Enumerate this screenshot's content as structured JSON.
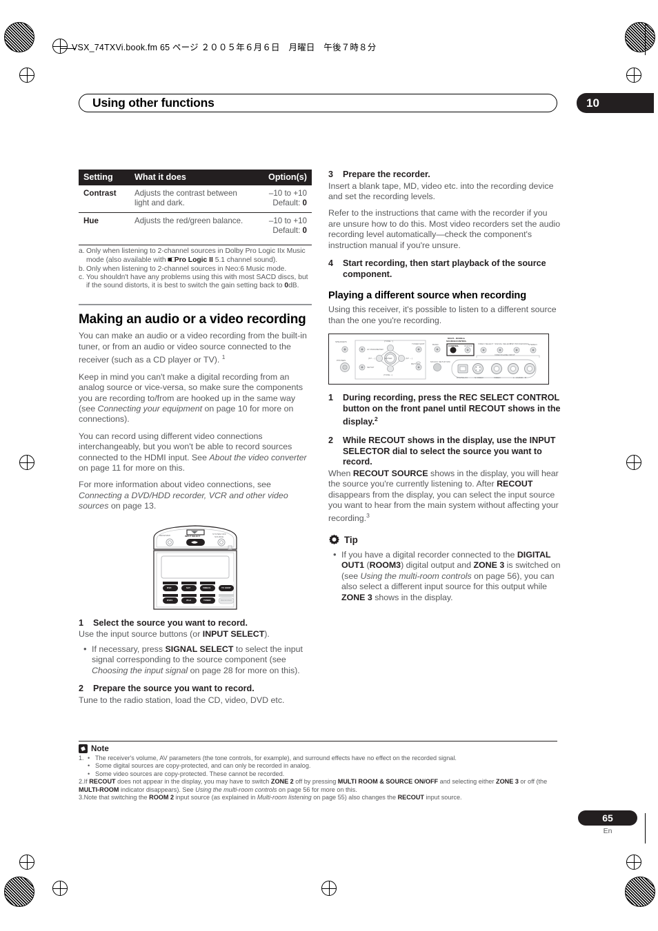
{
  "header": {
    "slug": "VSX_74TXVi.book.fm  65 ページ  ２００５年６月６日　月曜日　午後７時８分",
    "chapter_title": "Using other functions",
    "chapter_number": "10"
  },
  "settings_table": {
    "columns": [
      "Setting",
      "What it does",
      "Option(s)"
    ],
    "rows": [
      {
        "name": "Contrast",
        "desc": "Adjusts the contrast between light and dark.",
        "options_range": "–10 to +10",
        "options_default_label": "Default: ",
        "options_default_value": "0"
      },
      {
        "name": "Hue",
        "desc": "Adjusts the red/green balance.",
        "options_range": "–10 to +10",
        "options_default_label": "Default: ",
        "options_default_value": "0"
      }
    ],
    "footnotes": [
      {
        "label": "a.",
        "text_1": "Only when listening to 2-channel sources in Dolby Pro Logic IIx Music mode (also available with ",
        "glyph": "■□",
        "bold": "Pro Logic II",
        "text_2": " 5.1 channel sound)."
      },
      {
        "label": "b.",
        "text_1": "Only when listening to 2-channel sources in Neo:6 Music mode."
      },
      {
        "label": "c.",
        "text_1": "You shouldn't have any problems using this with most SACD discs, but if the sound distorts, it is best to switch the gain setting back to ",
        "bold": "0",
        "text_2": "dB."
      }
    ]
  },
  "left_column": {
    "section_title": "Making an audio or a video recording",
    "p1_a": "You can make an audio or a video recording from the built-in tuner, or from an audio or video source connected to the receiver (such as a CD player or TV).",
    "p1_sup": "1",
    "p2_a": "Keep in mind you can't make a digital recording from an analog source or vice-versa, so make sure the components you are recording to/from are hooked up in the same way (see ",
    "p2_i": "Connecting your equipment",
    "p2_b": " on page 10 for more on connections).",
    "p3_a": "You can record using different video connections interchangeably, but you won't be able to record sources connected to the HDMI input. See ",
    "p3_i": "About the video converter",
    "p3_b": " on page 11 for more on this.",
    "p4_a": "For more information about video connections, see ",
    "p4_i": "Connecting a DVD/HDD recorder, VCR and other video sources",
    "p4_b": " on page 13.",
    "remote_figure": {
      "label_receiver": "RECEIVER",
      "label_input_select": "INPUT SELECT",
      "label_system_off": "SYSTEM OFF",
      "label_source": "SOURCE",
      "buttons_row1_top": [
        "CD",
        "TV",
        "CD-R/CD2"
      ],
      "buttons_row1": [
        "DVD",
        "SAT",
        "VIDEO1",
        "TV CONT"
      ],
      "buttons_row2_top": [
        "VIDEO2",
        "CD-R",
        "MD/CD-R"
      ],
      "buttons_row2": [
        "DVR1",
        "iPod",
        "TUNER",
        "RECEIVER"
      ]
    },
    "steps": [
      {
        "num": "1",
        "head": "Select the source you want to record.",
        "body_a": "Use the input source buttons (or ",
        "body_b": "INPUT SELECT",
        "body_c": ").",
        "bullets": [
          {
            "a": "If necessary, press ",
            "b": "SIGNAL SELECT",
            "c": " to select the input signal corresponding to the source component (see ",
            "i": "Choosing the input signal",
            "d": " on page 28 for more on this)."
          }
        ]
      },
      {
        "num": "2",
        "head": "Prepare the source you want to record.",
        "body_a": "Tune to the radio station, load the CD, video, DVD etc."
      }
    ]
  },
  "right_column": {
    "steps_top": [
      {
        "num": "3",
        "head": "Prepare the recorder.",
        "body_a": "Insert a blank tape, MD, video etc. into the recording device and set the recording levels.",
        "body_b": "Refer to the instructions that came with the recorder if you are unsure how to do this. Most video recorders set the audio recording level automatically—check the component's instruction manual if you're unsure."
      },
      {
        "num": "4",
        "head": "Start recording, then start playback of the source component."
      }
    ],
    "section_title": "Playing a different source when recording",
    "intro": "Using this receiver, it's possible to listen to a different source than the one you're recording.",
    "panel_figure": {
      "labels": [
        "SPEAKERS",
        "PHONES",
        "AV PARAMETER",
        "SETUP",
        "ENTER",
        "(TUNE ↑)",
        "(TUNE ↓)",
        "(ST ←)",
        "(ST →)",
        "TUNER EDIT",
        "RETURN",
        "BAND",
        "MCACC SETUP MIC",
        "MULTI - ROOM &",
        "SOURCE/CONTROL",
        "CONTROL",
        "ON/OFF",
        "VIDEO SELECT",
        "SIGNAL SELECT",
        "DSP PROCESSING",
        "STEREO",
        "VIDEO/GAME INPUT",
        "DIGITAL IN",
        "S-VIDEO",
        "VIDEO",
        "L - AUDIO - R"
      ]
    },
    "steps_bottom": [
      {
        "num": "1",
        "head_a": "During recording, press the ",
        "head_b": "REC SELECT CONTROL",
        "head_c": " button on the front panel until ",
        "head_d": "RECOUT",
        "head_e": " shows in the display.",
        "head_sup": "2"
      },
      {
        "num": "2",
        "head_a": "While ",
        "head_b": "RECOUT",
        "head_c": " shows in the display, use the ",
        "head_d": "INPUT SELECTOR",
        "head_e": " dial to select the source you want to record.",
        "body_1a": "When ",
        "body_1b": "RECOUT SOURCE",
        "body_1c": " shows in the display, you will hear the source you're currently listening to. After ",
        "body_1d": "RECOUT",
        "body_1e": " disappears from the display, you can select the input source you want to hear from the main system without affecting your recording.",
        "body_sup": "3"
      }
    ],
    "tip": {
      "label": "Tip",
      "bullets": [
        {
          "a": "If you have a digital recorder connected to the ",
          "b1": "DIGITAL OUT1",
          "c1": " (",
          "b2": "ROOM3",
          "c2": ") digital output and ",
          "b3": "ZONE 3",
          "c3": " is switched on (see ",
          "i": "Using the multi-room controls",
          "c4": " on page 56), you can also select a different input source for this output while ",
          "b4": "ZONE 3",
          "c5": " shows in the display."
        }
      ]
    }
  },
  "notes": {
    "label": "Note",
    "items": [
      {
        "num": "1.",
        "lines": [
          {
            "bullet": "•",
            "a": "The receiver's volume, AV parameters (the tone controls, for example), and surround effects have no effect on the recorded signal."
          },
          {
            "bullet": "•",
            "a": "Some digital sources are copy-protected, and can only be recorded in analog."
          },
          {
            "bullet": "•",
            "a": "Some video sources are copy-protected. These cannot be recorded."
          }
        ]
      },
      {
        "num": "2.",
        "a": "If ",
        "b1": "RECOUT",
        "c1": " does not appear in the display, you may have to switch ",
        "b2": "ZONE 2",
        "c2": " off by pressing ",
        "b3": "MULTI ROOM & SOURCE ON/OFF",
        "c3": " and selecting either ",
        "b4": "ZONE 3",
        "c4": " or off (the ",
        "b5": "MULTI-ROOM",
        "c5": " indicator disappears). See ",
        "i": "Using the multi-room controls",
        "c6": " on page 56 for more on this."
      },
      {
        "num": "3.",
        "a": "Note that switching the ",
        "b1": "ROOM 2",
        "c1": " input source (as explained in ",
        "i": "Multi-room listening",
        "c2": " on page 55) also changes the ",
        "b2": "RECOUT",
        "c3": " input source."
      }
    ]
  },
  "footer": {
    "page_number": "65",
    "language_code": "En"
  }
}
